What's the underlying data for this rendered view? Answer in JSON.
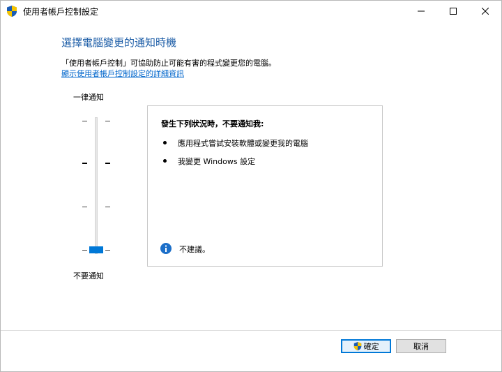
{
  "window": {
    "title": "使用者帳戶控制設定"
  },
  "main": {
    "heading": "選擇電腦變更的通知時機",
    "description": "「使用者帳戶控制」可協助防止可能有害的程式變更您的電腦。",
    "detail_link": "顯示使用者帳戶控制設定的詳細資訊"
  },
  "slider": {
    "top_label": "一律通知",
    "bottom_label": "不要通知",
    "levels": 4,
    "selected_level": 1
  },
  "info_box": {
    "title": "發生下列狀況時，不要通知我:",
    "items": [
      "應用程式嘗試安裝軟體或變更我的電腦",
      "我變更 Windows 設定"
    ],
    "note": "不建議。"
  },
  "footer": {
    "ok_label": "確定",
    "cancel_label": "取消"
  },
  "colors": {
    "heading": "#1f5fa8",
    "link": "#0066cc",
    "accent": "#0078d7"
  }
}
